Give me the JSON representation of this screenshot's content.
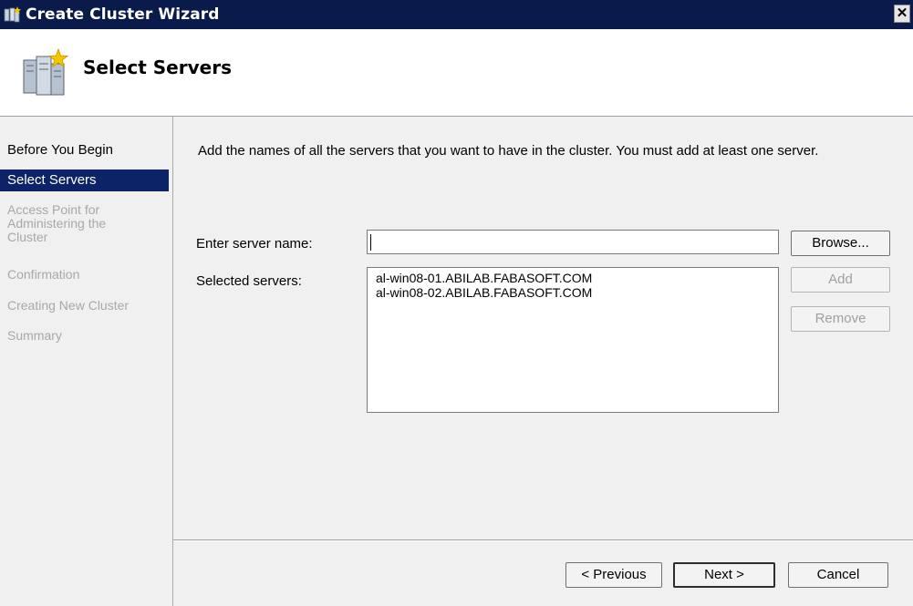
{
  "window": {
    "title": "Create Cluster Wizard",
    "close_glyph": "✕"
  },
  "header": {
    "title": "Select Servers"
  },
  "sidebar": {
    "items": [
      {
        "label": "Before You Begin",
        "state": "normal"
      },
      {
        "label": "Select Servers",
        "state": "active"
      },
      {
        "label": "Access Point for Administering the Cluster",
        "state": "disabled"
      },
      {
        "label": "Confirmation",
        "state": "disabled"
      },
      {
        "label": "Creating New Cluster",
        "state": "disabled"
      },
      {
        "label": "Summary",
        "state": "disabled"
      }
    ]
  },
  "main": {
    "intro": "Add the names of all the servers that you want to have in the cluster. You must add at least one server.",
    "server_name_label": "Enter server name:",
    "server_name_value": "",
    "selected_servers_label": "Selected servers:",
    "selected_servers": [
      "al-win08-01.ABILAB.FABASOFT.COM",
      "al-win08-02.ABILAB.FABASOFT.COM"
    ],
    "browse_label": "Browse...",
    "add_label": "Add",
    "remove_label": "Remove"
  },
  "footer": {
    "previous_label": "< Previous",
    "next_label": "Next >",
    "cancel_label": "Cancel"
  },
  "colors": {
    "titlebar": "#0a1a4a",
    "active_nav": "#0c2368",
    "panel": "#f0f0f0",
    "disabled_text": "#a8a8a8"
  }
}
